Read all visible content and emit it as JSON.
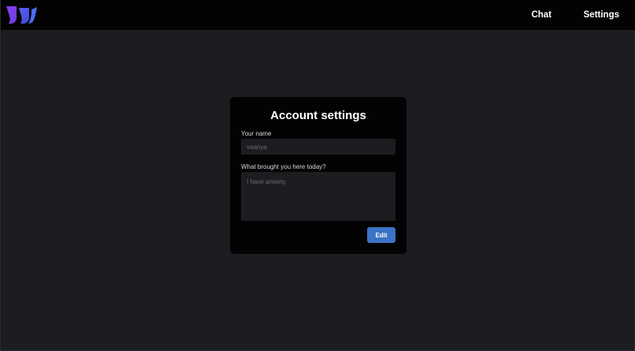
{
  "nav": {
    "chat_label": "Chat",
    "settings_label": "Settings"
  },
  "logo": {
    "icon": "double-leaf-logo",
    "colors": [
      "#7b3fe4",
      "#4f5ef0"
    ]
  },
  "account_settings": {
    "title": "Account settings",
    "name_label": "Your name",
    "name_value": "vaanya",
    "reason_label": "What brought you here today?",
    "reason_value": "I have anxiety.",
    "edit_label": "Edit"
  },
  "colors": {
    "background": "#1c1d21",
    "navbar": "#030303",
    "card": "#030303",
    "button": "#3b73c5"
  }
}
